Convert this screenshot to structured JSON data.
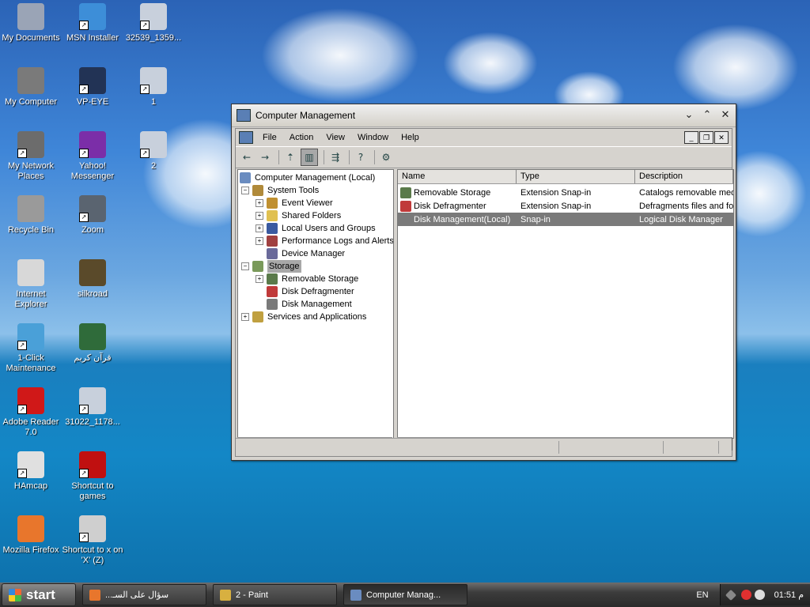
{
  "desktop": {
    "icons": [
      {
        "label": "My Documents",
        "icon": "folder-documents-icon",
        "color": "#9aa4b6"
      },
      {
        "label": "MSN Installer",
        "icon": "msn-butterfly-icon",
        "color": "#3d8ed8"
      },
      {
        "label": "32539_1359...",
        "icon": "network-computers-icon",
        "color": "#c8d0dc"
      },
      {
        "label": "My Computer",
        "icon": "computer-icon",
        "color": "#7a7a7a"
      },
      {
        "label": "VP-EYE",
        "icon": "eye-icon",
        "color": "#223355"
      },
      {
        "label": "1",
        "icon": "network-computers-icon",
        "color": "#c8d0dc"
      },
      {
        "label": "My Network Places",
        "icon": "network-places-icon",
        "color": "#6c6c6c"
      },
      {
        "label": "Yahoo! Messenger",
        "icon": "yahoo-messenger-icon",
        "color": "#7b2ea8"
      },
      {
        "label": "2",
        "icon": "network-computers-icon",
        "color": "#c8d0dc"
      },
      {
        "label": "Recycle Bin",
        "icon": "recycle-bin-icon",
        "color": "#9a9a9a"
      },
      {
        "label": "Zoom",
        "icon": "binoculars-icon",
        "color": "#5a6470"
      },
      {
        "label": "Internet Explorer",
        "icon": "internet-explorer-icon",
        "color": "#d8d8d8"
      },
      {
        "label": "silkroad",
        "icon": "silkroad-icon",
        "color": "#5a4a2a"
      },
      {
        "label": "1-Click Maintenance",
        "icon": "maintenance-icon",
        "color": "#4aa0d8"
      },
      {
        "label": "قرآن كريم",
        "icon": "quran-book-icon",
        "color": "#2f6b3a"
      },
      {
        "label": "Adobe Reader 7.0",
        "icon": "adobe-reader-icon",
        "color": "#d01818"
      },
      {
        "label": "31022_1178...",
        "icon": "network-computers-icon",
        "color": "#c8d0dc"
      },
      {
        "label": "HAmcap",
        "icon": "hamcap-icon",
        "color": "#e0e0e0"
      },
      {
        "label": "Shortcut to games",
        "icon": "games-icon",
        "color": "#c01010"
      },
      {
        "label": "Mozilla Firefox",
        "icon": "firefox-icon",
        "color": "#e8762c"
      },
      {
        "label": "Shortcut to x on 'X' (Z)",
        "icon": "drive-icon",
        "color": "#cfcfcf"
      }
    ]
  },
  "window": {
    "title": "Computer Management",
    "title_buttons": [
      "⌄",
      "⌃",
      "✕"
    ],
    "menu": [
      "File",
      "Action",
      "View",
      "Window",
      "Help"
    ],
    "mdi_buttons": [
      "_",
      "❐",
      "✕"
    ],
    "toolbar": [
      {
        "name": "back-icon",
        "glyph": "←"
      },
      {
        "name": "forward-icon",
        "glyph": "→"
      },
      {
        "name": "up-folder-icon",
        "glyph": "⇡"
      },
      {
        "name": "show-hide-tree-icon",
        "glyph": "▥"
      },
      {
        "name": "export-list-icon",
        "glyph": "⇶"
      },
      {
        "name": "help-icon",
        "glyph": "?"
      },
      {
        "name": "properties-icon",
        "glyph": "⚙"
      }
    ],
    "tree": [
      {
        "label": "Computer Management (Local)",
        "level": 0,
        "expander": "",
        "icon": "computer-management-icon",
        "color": "#6a8cc0",
        "selected": false
      },
      {
        "label": "System Tools",
        "level": 1,
        "expander": "−",
        "icon": "system-tools-icon",
        "color": "#b08a3a",
        "selected": false
      },
      {
        "label": "Event Viewer",
        "level": 2,
        "expander": "+",
        "icon": "event-viewer-icon",
        "color": "#c09030",
        "selected": false
      },
      {
        "label": "Shared Folders",
        "level": 2,
        "expander": "+",
        "icon": "shared-folders-icon",
        "color": "#e0c050",
        "selected": false
      },
      {
        "label": "Local Users and Groups",
        "level": 2,
        "expander": "+",
        "icon": "users-icon",
        "color": "#3a5aa0",
        "selected": false
      },
      {
        "label": "Performance Logs and Alerts",
        "level": 2,
        "expander": "+",
        "icon": "performance-icon",
        "color": "#a04040",
        "selected": false
      },
      {
        "label": "Device Manager",
        "level": 2,
        "expander": "",
        "icon": "device-manager-icon",
        "color": "#6a6a9a",
        "selected": false
      },
      {
        "label": "Storage",
        "level": 1,
        "expander": "−",
        "icon": "storage-icon",
        "color": "#7a9a5a",
        "selected": true
      },
      {
        "label": "Removable Storage",
        "level": 2,
        "expander": "+",
        "icon": "removable-storage-icon",
        "color": "#5a7a4a",
        "selected": false
      },
      {
        "label": "Disk Defragmenter",
        "level": 2,
        "expander": "",
        "icon": "defragmenter-icon",
        "color": "#c03a3a",
        "selected": false
      },
      {
        "label": "Disk Management",
        "level": 2,
        "expander": "",
        "icon": "disk-management-icon",
        "color": "#7a7a7a",
        "selected": false
      },
      {
        "label": "Services and Applications",
        "level": 1,
        "expander": "+",
        "icon": "services-icon",
        "color": "#c0a040",
        "selected": false
      }
    ],
    "list": {
      "columns": [
        "Name",
        "Type",
        "Description"
      ],
      "rows": [
        {
          "name": "Removable Storage",
          "type": "Extension Snap-in",
          "description": "Catalogs removable med",
          "icon": "removable-storage-icon",
          "color": "#5a7a4a",
          "selected": false
        },
        {
          "name": "Disk Defragmenter",
          "type": "Extension Snap-in",
          "description": "Defragments files and fo",
          "icon": "defragmenter-icon",
          "color": "#c03a3a",
          "selected": false
        },
        {
          "name": "Disk Management(Local)",
          "type": "Snap-in",
          "description": "Logical Disk Manager",
          "icon": "disk-management-icon",
          "color": "#7a7a7a",
          "selected": true
        }
      ]
    },
    "scroll_thumb_glyph": "|||",
    "scroll_left": "◀",
    "scroll_right": "▶"
  },
  "taskbar": {
    "start_label": "start",
    "tasks": [
      {
        "label": "...سؤال على السـ",
        "icon": "firefox-icon",
        "color": "#e8762c",
        "active": false
      },
      {
        "label": "2 - Paint",
        "icon": "paint-icon",
        "color": "#d8b040",
        "active": false
      },
      {
        "label": "Computer Manag...",
        "icon": "computer-management-icon",
        "color": "#6a8cc0",
        "active": true
      }
    ],
    "language": "EN",
    "clock": "01:51 م"
  }
}
